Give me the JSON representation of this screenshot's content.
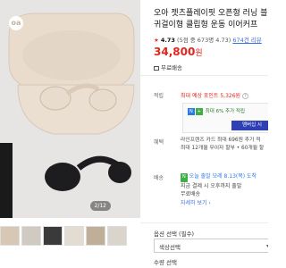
{
  "gallery": {
    "logo_text": "oa",
    "counter": "2/12",
    "thumbnail_count": 6
  },
  "product": {
    "title_line1": "오아 젯츠플레이핏 오픈형 러닝 블",
    "title_line2": "귀걸이형 클립형 운동 이어커프",
    "rating_star": "★",
    "rating_score": "4.73",
    "rating_detail": "(5점 중 673명 4.73)",
    "review_count": "674건 리뷰",
    "price_value": "34,800",
    "price_unit": "원",
    "shipping_free": "무료배송"
  },
  "points": {
    "label": "적립",
    "line": "최대 예상 포인트 5,326원",
    "promo_row": "최대 6% 추가 적립",
    "promo_button": "멤버십 시"
  },
  "benefits": {
    "label": "혜택",
    "line1": "라인프렌즈 카드 최대 696원 추가 적",
    "line2": "최대 12개월 무이자 할부 • 60개월 할"
  },
  "delivery": {
    "label": "배송",
    "badge": "N",
    "arrive": "오늘 출발",
    "arrive_date": "모레 8.13(목) 도착",
    "line2": "지금 결제 시 오후까지 출발",
    "line3": "무료배송",
    "detail_link": "자세히 보기 ›"
  },
  "options": {
    "section_title": "옵션 선택 (필수)",
    "selected": "색상선택",
    "qty_title": "수량 선택"
  },
  "colors": {
    "price_red": "#e1261c",
    "link_blue": "#3a6fd8",
    "promo_navy": "#2f3fb5",
    "badge_green": "#3fae49",
    "bg_photo": "#e6e5e3"
  }
}
